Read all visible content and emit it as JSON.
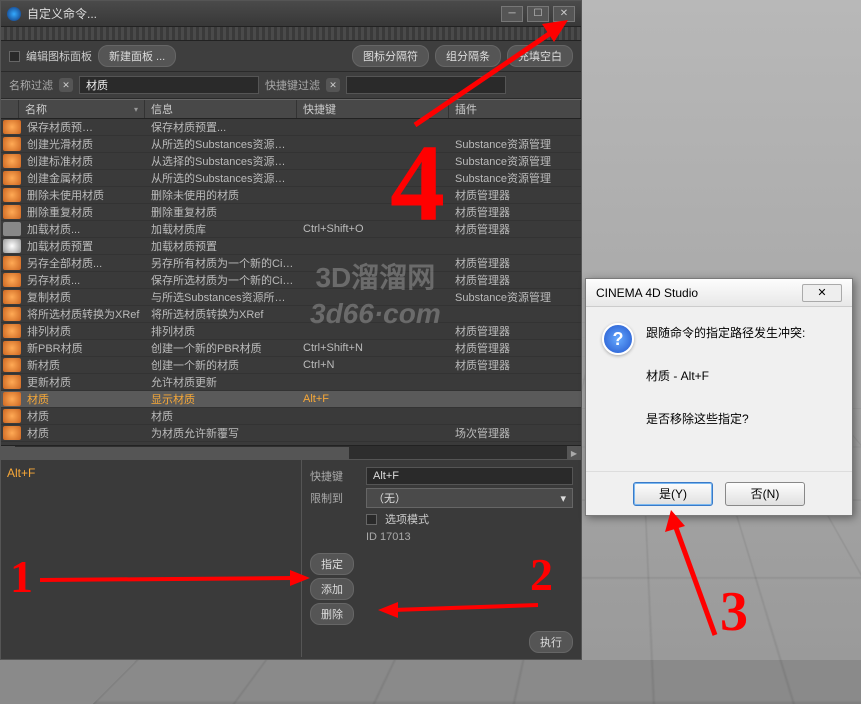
{
  "window": {
    "title": "自定义命令...",
    "min_icon": "─",
    "max_icon": "☐",
    "close_icon": "✕"
  },
  "toolbar": {
    "edit_icon_panel": "编辑图标面板",
    "new_panel": "新建面板 ...",
    "icon_separator": "图标分隔符",
    "group_end": "组分隔条",
    "fill_blank": "充填空白"
  },
  "filters": {
    "name_label": "名称过滤",
    "name_value": "材质",
    "shortcut_label": "快捷键过滤",
    "shortcut_value": ""
  },
  "columns": {
    "name": "名称",
    "info": "信息",
    "shortcut": "快捷键",
    "plugin": "插件"
  },
  "rows": [
    {
      "icon": "ic-orange",
      "name": "保存材质预…",
      "info": "保存材质预置...",
      "shortcut": "",
      "plugin": ""
    },
    {
      "icon": "ic-orange",
      "name": "创建光滑材质",
      "info": "从所选的Substances资源创建…",
      "shortcut": "",
      "plugin": "Substance资源管理"
    },
    {
      "icon": "ic-orange",
      "name": "创建标准材质",
      "info": "从选择的Substances资源创建…",
      "shortcut": "",
      "plugin": "Substance资源管理"
    },
    {
      "icon": "ic-orange",
      "name": "创建金属材质",
      "info": "从所选的Substances资源创建…",
      "shortcut": "",
      "plugin": "Substance资源管理"
    },
    {
      "icon": "ic-orange",
      "name": "删除未使用材质",
      "info": "删除未使用的材质",
      "shortcut": "",
      "plugin": "材质管理器"
    },
    {
      "icon": "ic-orange",
      "name": "删除重复材质",
      "info": "删除重复材质",
      "shortcut": "",
      "plugin": "材质管理器"
    },
    {
      "icon": "ic-grey",
      "name": "加载材质...",
      "info": "加载材质库",
      "shortcut": "Ctrl+Shift+O",
      "plugin": "材质管理器"
    },
    {
      "icon": "ic-white",
      "name": "加载材质预置",
      "info": "加载材质预置",
      "shortcut": "",
      "plugin": ""
    },
    {
      "icon": "ic-orange",
      "name": "另存全部材质...",
      "info": "另存所有材质为一个新的Cinem",
      "shortcut": "",
      "plugin": "材质管理器"
    },
    {
      "icon": "ic-orange",
      "name": "另存材质...",
      "info": "保存所选材质为一个新的Cinem",
      "shortcut": "",
      "plugin": "材质管理器"
    },
    {
      "icon": "ic-orange",
      "name": "复制材质",
      "info": "与所选Substances资源所参考",
      "shortcut": "",
      "plugin": "Substance资源管理"
    },
    {
      "icon": "ic-orange",
      "name": "将所选材质转换为XRef",
      "info": "将所选材质转换为XRef",
      "shortcut": "",
      "plugin": ""
    },
    {
      "icon": "ic-orange",
      "name": "排列材质",
      "info": "排列材质",
      "shortcut": "",
      "plugin": "材质管理器"
    },
    {
      "icon": "ic-orange",
      "name": "新PBR材质",
      "info": "创建一个新的PBR材质",
      "shortcut": "Ctrl+Shift+N",
      "plugin": "材质管理器"
    },
    {
      "icon": "ic-orange",
      "name": "新材质",
      "info": "创建一个新的材质",
      "shortcut": "Ctrl+N",
      "plugin": "材质管理器"
    },
    {
      "icon": "ic-orange",
      "name": "更新材质",
      "info": "允许材质更新",
      "shortcut": "",
      "plugin": ""
    },
    {
      "icon": "ic-orange",
      "name": "材质",
      "info": "显示材质",
      "shortcut": "Alt+F",
      "plugin": "",
      "selected": true
    },
    {
      "icon": "ic-orange",
      "name": "材质",
      "info": "材质",
      "shortcut": "",
      "plugin": ""
    },
    {
      "icon": "ic-orange",
      "name": "材质",
      "info": "为材质允许新覆写",
      "shortcut": "",
      "plugin": "场次管理器"
    }
  ],
  "assigned_shortcut": "Alt+F",
  "form": {
    "shortcut_label": "快捷键",
    "shortcut_value": "Alt+F",
    "restrict_label": "限制到",
    "restrict_value": "（无）",
    "options_mode": "选项模式",
    "id_label": "ID 17013",
    "assign_btn": "指定",
    "add_btn": "添加",
    "delete_btn": "删除",
    "execute_btn": "执行"
  },
  "dialog": {
    "title": "CINEMA 4D Studio",
    "line1": "跟随命令的指定路径发生冲突:",
    "line2": "材质 - Alt+F",
    "line3": "是否移除这些指定?",
    "yes": "是(Y)",
    "no": "否(N)"
  },
  "watermark": {
    "l1": "3D溜溜网",
    "l2": "3d66·com"
  },
  "annotations": {
    "n1": "1",
    "n2": "2",
    "n3": "3",
    "n4": "4"
  }
}
